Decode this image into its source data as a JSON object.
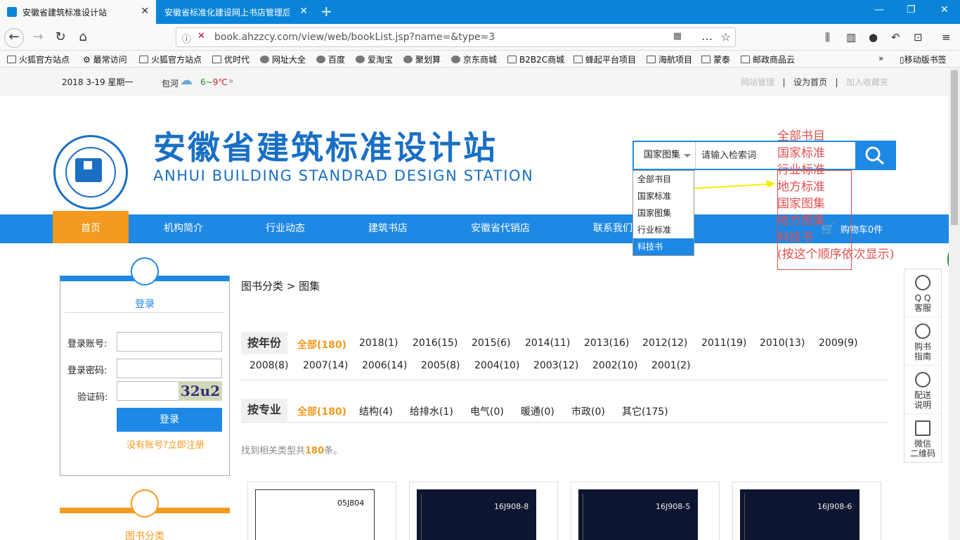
{
  "browser": {
    "tabs": [
      {
        "label": "安徽省建筑标准设计站"
      },
      {
        "label": "安徽省标准化建设网上书店管理后台"
      }
    ],
    "url": "book.ahzzcy.com/view/web/bookList.jsp?name=&type=3",
    "bookmarks": [
      "火狐官方站点",
      "最常访问",
      "火狐官方站点",
      "优时代",
      "网址大全",
      "百度",
      "爱淘宝",
      "聚划算",
      "京东商城",
      "B2B2C商城",
      "蜂起平台项目",
      "海航项目",
      "蒙泰",
      "邮政商品云"
    ],
    "bookmarks_more": "»",
    "mobile_bookmarks": "移动版书签"
  },
  "topbar": {
    "date": "2018 3-19 星期一",
    "city": "包河",
    "temp_low": "6~",
    "temp_high": "9℃",
    "more": "»",
    "links": [
      "网站管理",
      "设为首页",
      "加入收藏夹"
    ],
    "sep": "|"
  },
  "header": {
    "title": "安徽省建筑标准设计站",
    "subtitle": "ANHUI BUILDING STANDRAD DESIGN STATION"
  },
  "search": {
    "selected": "国家图集",
    "placeholder": "请输入检索词",
    "options": [
      "全部书目",
      "国家标准",
      "国家图集",
      "行业标准",
      "科技书"
    ]
  },
  "nav": {
    "items": [
      "首页",
      "机构简介",
      "行业动态",
      "建筑书店",
      "安徽省代销店",
      "联系我们"
    ],
    "cart": "购物车0件"
  },
  "login": {
    "title": "登录",
    "account_label": "登录账号:",
    "password_label": "登录密码:",
    "captcha_label": "验证码:",
    "captcha_text": "32u2",
    "submit": "登录",
    "register": "没有账号?立即注册"
  },
  "category_panel": {
    "title": "图书分类"
  },
  "breadcrumb": "图书分类 > 图集",
  "filters": {
    "year_title": "按年份",
    "years": [
      "全部(180)",
      "2018(1)",
      "2016(15)",
      "2015(6)",
      "2014(11)",
      "2013(16)",
      "2012(12)",
      "2011(19)",
      "2010(13)",
      "2009(9)",
      "2008(8)",
      "2007(14)",
      "2006(14)",
      "2005(8)",
      "2004(10)",
      "2003(12)",
      "2002(10)",
      "2001(2)"
    ],
    "major_title": "按专业",
    "majors": [
      "全部(180)",
      "结构(4)",
      "给排水(1)",
      "电气(0)",
      "暖通(0)",
      "市政(0)",
      "其它(175)"
    ]
  },
  "found": {
    "prefix": "找到相关类型共",
    "count": "180",
    "suffix": "条。"
  },
  "books": [
    {
      "code": "05J804"
    },
    {
      "code": "16J908-8"
    },
    {
      "code": "16J908-5"
    },
    {
      "code": "16J908-6"
    }
  ],
  "side_float": [
    {
      "label1": "Q Q",
      "label2": "客服"
    },
    {
      "label1": "购书",
      "label2": "指南"
    },
    {
      "label1": "配送",
      "label2": "说明"
    },
    {
      "label1": "微信",
      "label2": "二维码"
    }
  ],
  "annotation": {
    "lines": [
      "全部书目",
      "国家标准",
      "行业标准",
      "地方标准",
      "国家图集",
      "地方图集",
      "科技书",
      "(按这个顺序依次显示)"
    ]
  },
  "colors": {
    "primary": "#1e88e5",
    "accent": "#f39a1f",
    "annotation": "#e05050"
  }
}
